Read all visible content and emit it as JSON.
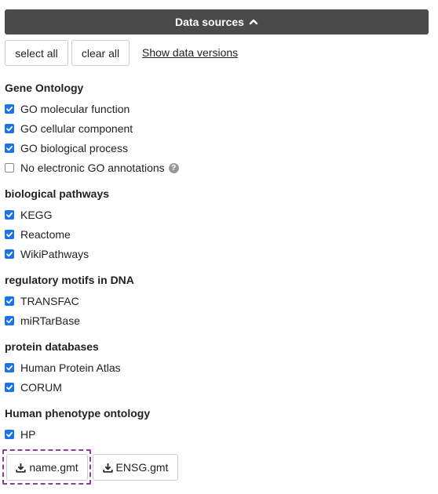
{
  "header": {
    "title": "Data sources"
  },
  "controls": {
    "select_all": "select all",
    "clear_all": "clear all",
    "show_versions": "Show data versions"
  },
  "sections": {
    "go": {
      "title": "Gene Ontology",
      "items": [
        {
          "label": "GO molecular function",
          "checked": true
        },
        {
          "label": "GO cellular component",
          "checked": true
        },
        {
          "label": "GO biological process",
          "checked": true
        },
        {
          "label": "No electronic GO annotations",
          "checked": false
        }
      ]
    },
    "pathways": {
      "title": "biological pathways",
      "items": [
        {
          "label": "KEGG",
          "checked": true
        },
        {
          "label": "Reactome",
          "checked": true
        },
        {
          "label": "WikiPathways",
          "checked": true
        }
      ]
    },
    "motifs": {
      "title": "regulatory motifs in DNA",
      "items": [
        {
          "label": "TRANSFAC",
          "checked": true
        },
        {
          "label": "miRTarBase",
          "checked": true
        }
      ]
    },
    "protein": {
      "title": "protein databases",
      "items": [
        {
          "label": "Human Protein Atlas",
          "checked": true
        },
        {
          "label": "CORUM",
          "checked": true
        }
      ]
    },
    "phenotype": {
      "title": "Human phenotype ontology",
      "items": [
        {
          "label": "HP",
          "checked": true
        }
      ]
    }
  },
  "downloads": {
    "name_gmt": "name.gmt",
    "ensg_gmt": "ENSG.gmt"
  },
  "colors": {
    "header_bg": "#4a4a4a",
    "checkbox_on": "#1a73e8",
    "focus_outline": "#8e3c9b"
  }
}
